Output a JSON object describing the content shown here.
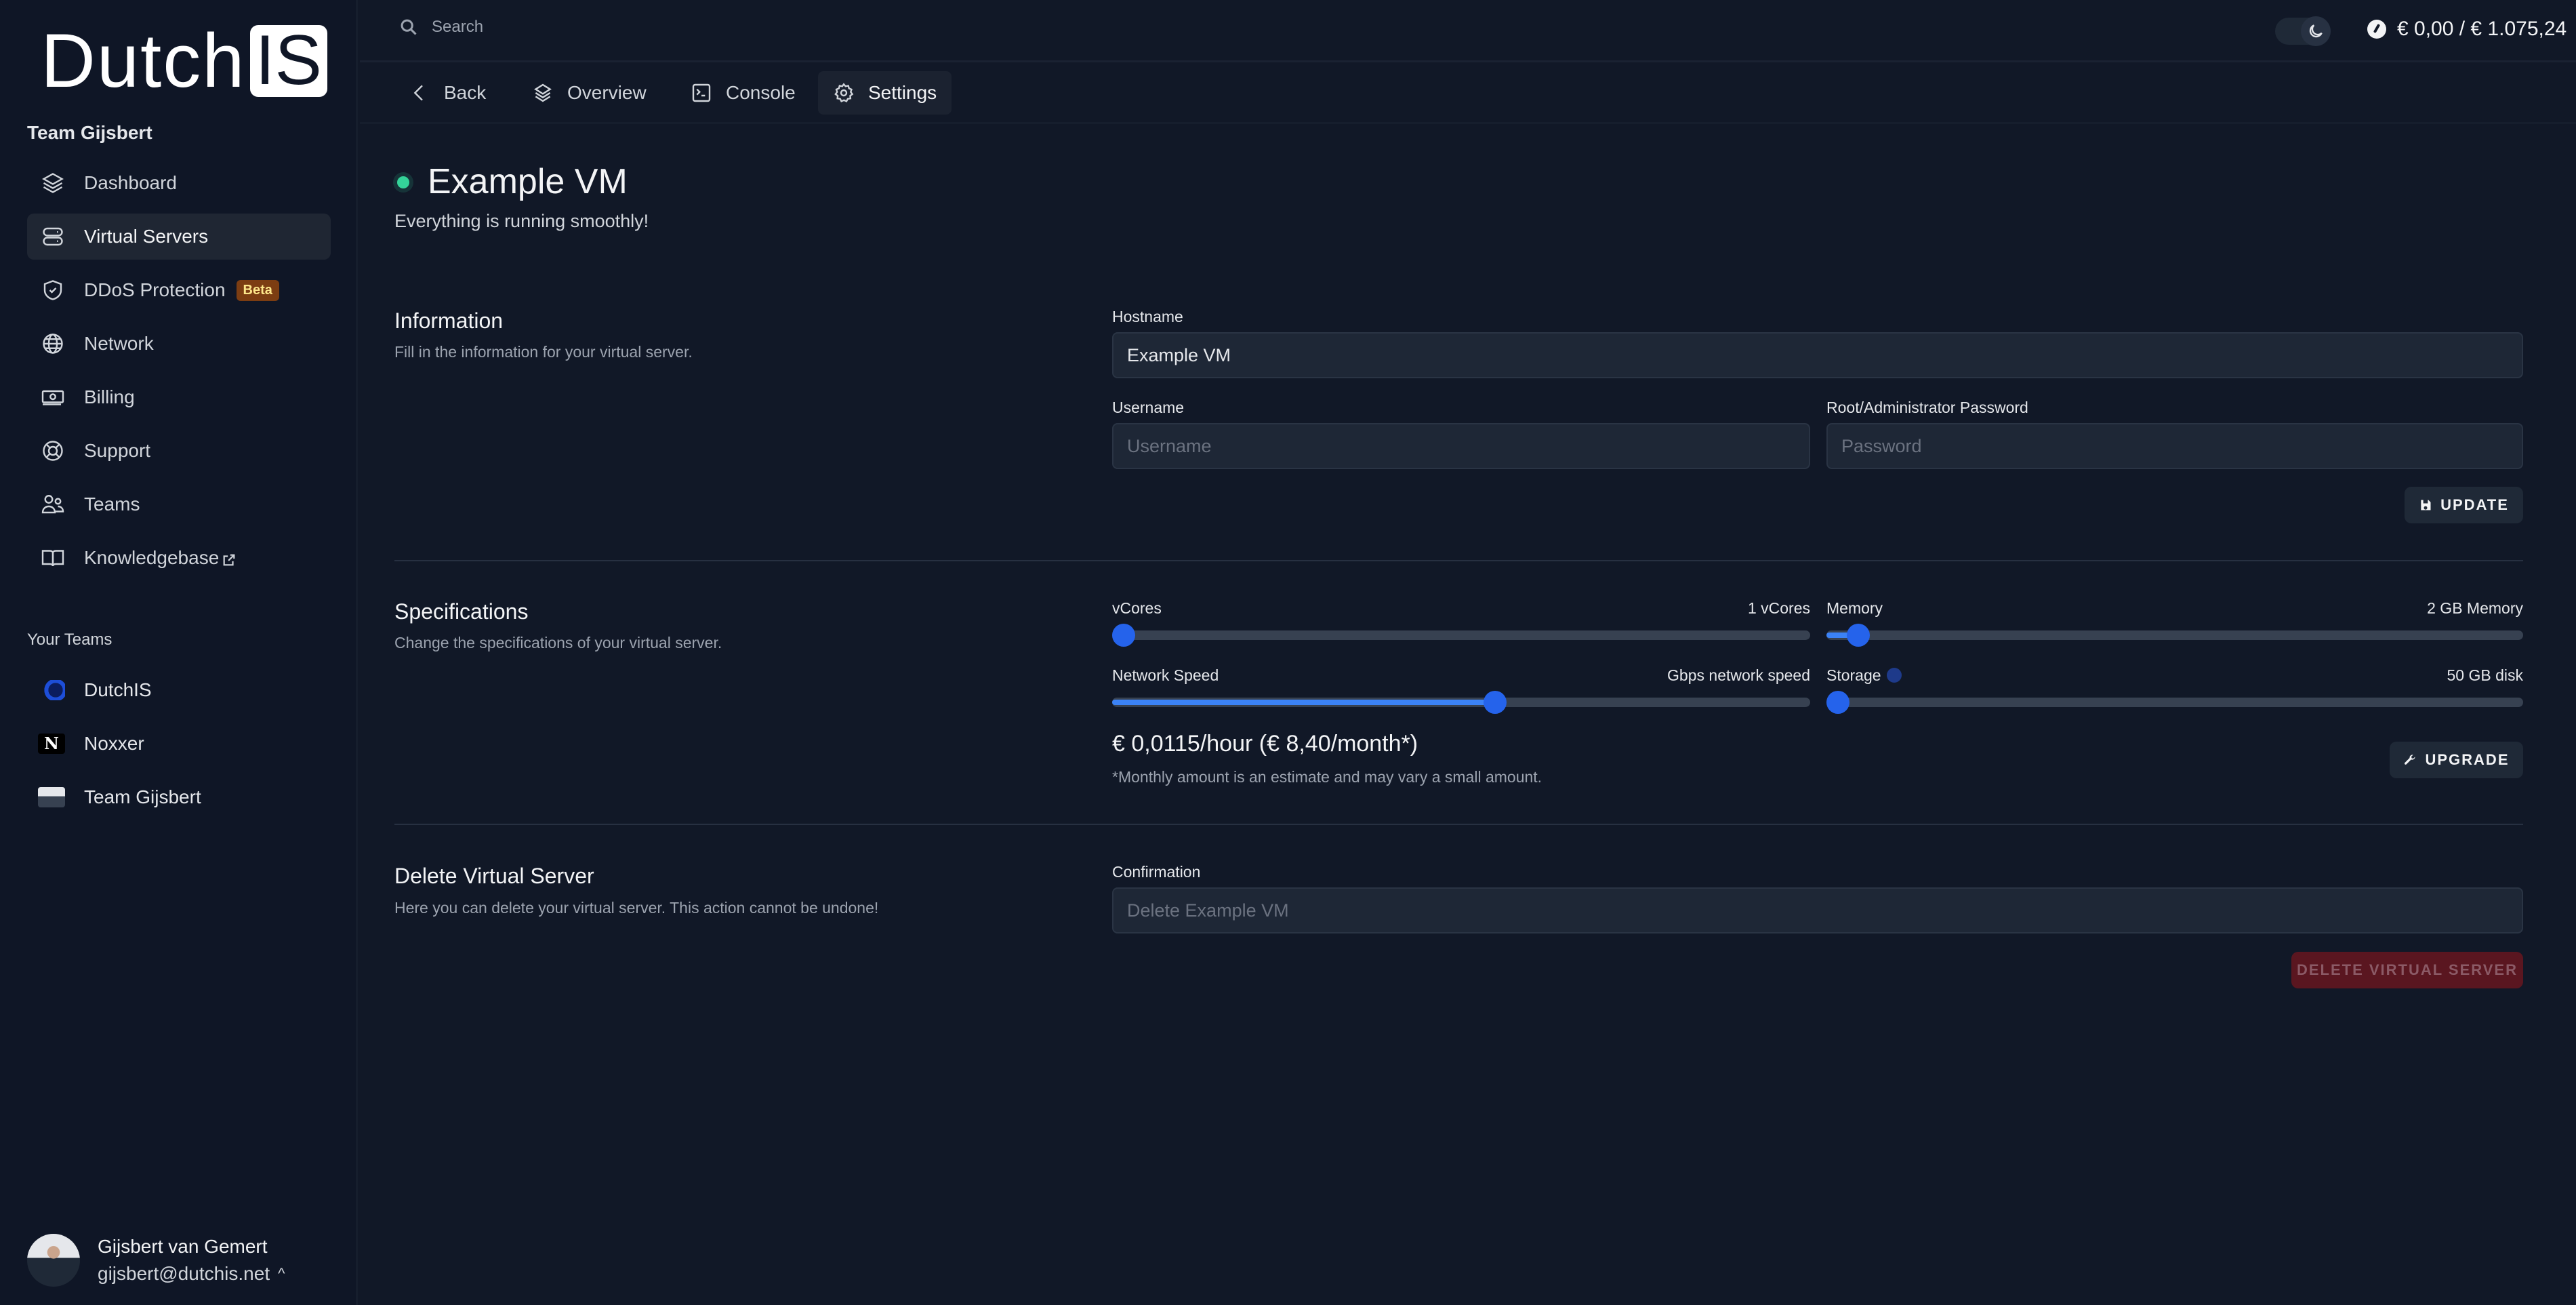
{
  "brand": {
    "word": "Dutch",
    "boxed": "IS"
  },
  "sidebar": {
    "team_title": "Team Gijsbert",
    "items": [
      {
        "label": "Dashboard",
        "icon": "layers-icon",
        "active": false
      },
      {
        "label": "Virtual Servers",
        "icon": "server-icon",
        "active": true
      },
      {
        "label": "DDoS Protection",
        "icon": "shield-check-icon",
        "badge": "Beta",
        "active": false
      },
      {
        "label": "Network",
        "icon": "globe-icon",
        "active": false
      },
      {
        "label": "Billing",
        "icon": "banknotes-icon",
        "active": false
      },
      {
        "label": "Support",
        "icon": "lifebuoy-icon",
        "active": false
      },
      {
        "label": "Teams",
        "icon": "users-icon",
        "active": false
      },
      {
        "label": "Knowledgebase",
        "icon": "book-open-icon",
        "external": true,
        "active": false
      }
    ],
    "teams_title": "Your Teams",
    "teams": [
      {
        "name": "DutchIS",
        "avatar": "dutchis-logo"
      },
      {
        "name": "Noxxer",
        "avatar": "noxxer-logo",
        "letter": "N"
      },
      {
        "name": "Team Gijsbert",
        "avatar": "team-photo"
      }
    ],
    "user": {
      "name": "Gijsbert van Gemert",
      "email": "gijsbert@dutchis.net",
      "caret": "^"
    }
  },
  "topbar": {
    "search_placeholder": "Search",
    "theme": "dark",
    "balance": "€ 0,00 / € 1.075,24"
  },
  "tabs": [
    {
      "label": "Back",
      "icon": "chevron-left-icon",
      "active": false
    },
    {
      "label": "Overview",
      "icon": "layers-icon",
      "active": false
    },
    {
      "label": "Console",
      "icon": "terminal-icon",
      "active": false
    },
    {
      "label": "Settings",
      "icon": "gear-icon",
      "active": true
    }
  ],
  "vm": {
    "name": "Example VM",
    "status_text": "Everything is running smoothly!",
    "status_color": "#34d399"
  },
  "information": {
    "title": "Information",
    "description": "Fill in the information for your virtual server.",
    "hostname_label": "Hostname",
    "hostname_value": "Example VM",
    "username_label": "Username",
    "username_placeholder": "Username",
    "password_label": "Root/Administrator Password",
    "password_placeholder": "Password",
    "update_label": "UPDATE"
  },
  "specifications": {
    "title": "Specifications",
    "description": "Change the specifications of your virtual server.",
    "sliders": {
      "vcores": {
        "label": "vCores",
        "value_text": "1 vCores",
        "fraction": 0.0
      },
      "memory": {
        "label": "Memory",
        "value_text": "2 GB Memory",
        "fraction": 0.03
      },
      "network": {
        "label": "Network Speed",
        "value_text": "Gbps network speed",
        "fraction": 0.55
      },
      "storage": {
        "label": "Storage",
        "value_text": "50 GB disk",
        "fraction": 0.0,
        "info": true
      }
    },
    "price": "€ 0,0115/hour (€ 8,40/month*)",
    "price_note": "*Monthly amount is an estimate and may vary a small amount.",
    "upgrade_label": "UPGRADE"
  },
  "delete": {
    "title": "Delete Virtual Server",
    "description": "Here you can delete your virtual server. This action cannot be undone!",
    "confirmation_label": "Confirmation",
    "confirmation_placeholder": "Delete Example VM",
    "button_label": "DELETE VIRTUAL SERVER",
    "button_disabled": true
  }
}
